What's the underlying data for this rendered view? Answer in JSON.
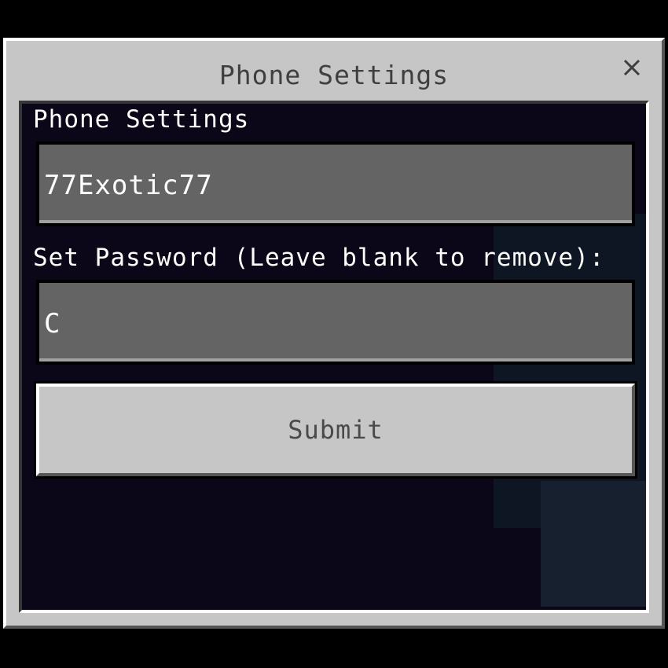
{
  "window": {
    "title": "Phone Settings",
    "close_icon": "close-icon"
  },
  "form": {
    "heading": "Phone Settings",
    "name_value": "77Exotic77",
    "password_label": "Set Password (Leave blank to remove):",
    "password_value": "C",
    "submit_label": "Submit"
  },
  "colors": {
    "dialog": "#c6c6c6",
    "content_bg": "#0b0718",
    "field": "#646464",
    "text_light": "#ffffff",
    "text_dark": "#3f3f3f"
  }
}
